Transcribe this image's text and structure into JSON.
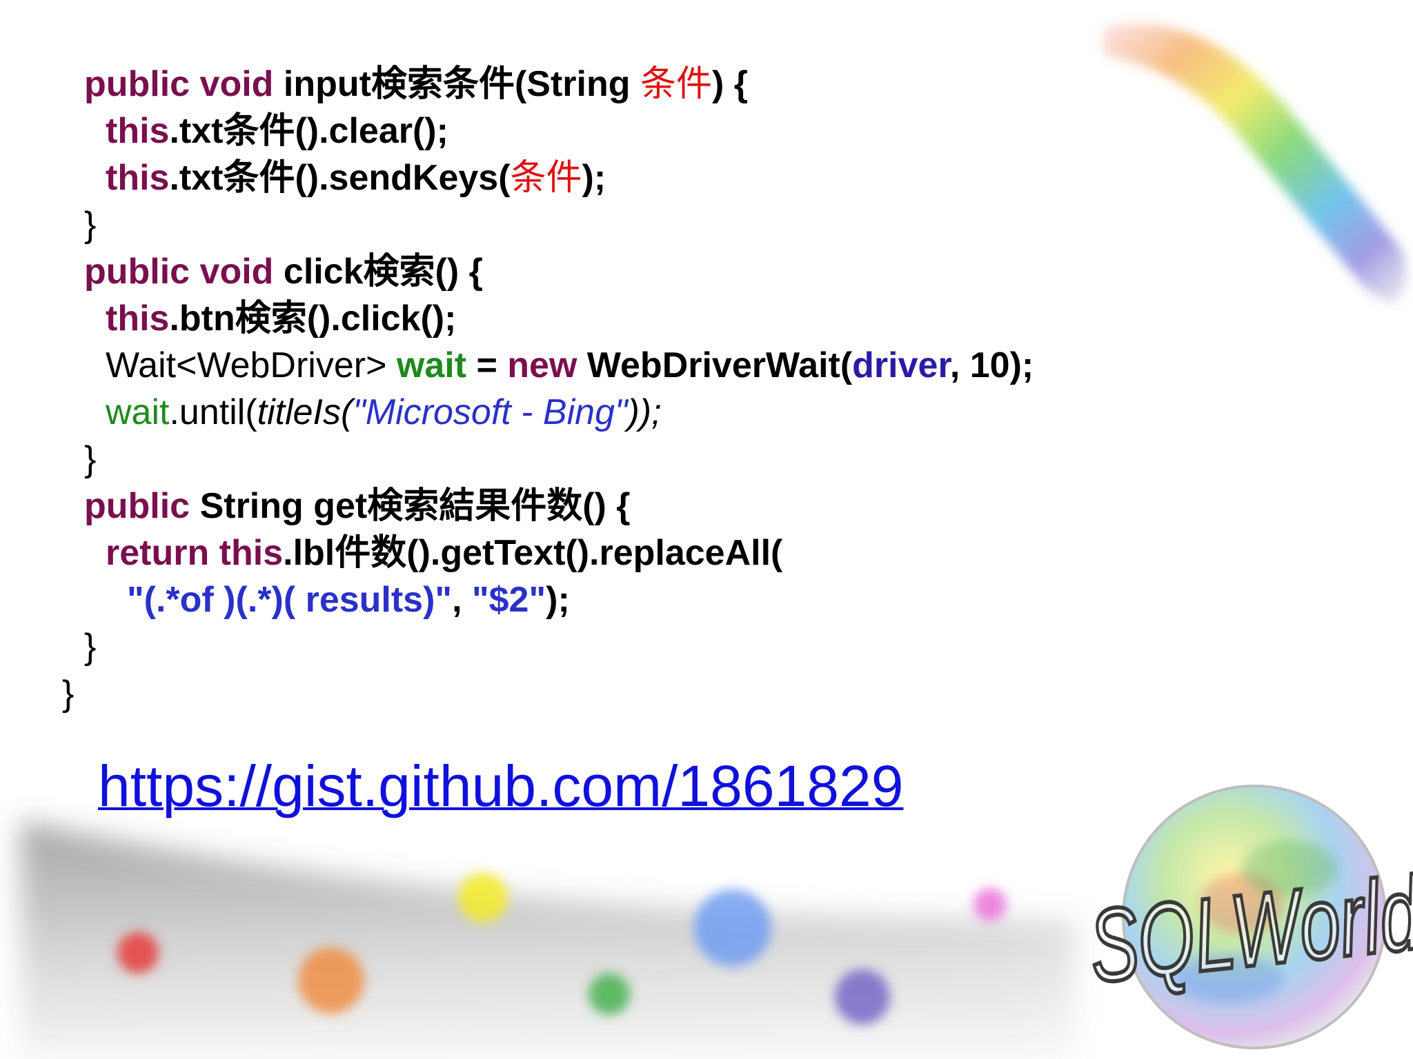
{
  "code": {
    "lines": [
      {
        "indent": 1,
        "tokens": [
          {
            "c": "kw",
            "t": "public void "
          },
          {
            "c": "b",
            "t": "input検索条件(String "
          },
          {
            "c": "param",
            "t": "条件"
          },
          {
            "c": "b",
            "t": ") {"
          }
        ]
      },
      {
        "indent": 2,
        "tokens": [
          {
            "c": "kw",
            "t": "this"
          },
          {
            "c": "b",
            "t": ".txt条件().clear();"
          }
        ]
      },
      {
        "indent": 2,
        "tokens": [
          {
            "c": "kw",
            "t": "this"
          },
          {
            "c": "b",
            "t": ".txt条件().sendKeys("
          },
          {
            "c": "param",
            "t": "条件"
          },
          {
            "c": "b",
            "t": ");"
          }
        ]
      },
      {
        "indent": 1,
        "tokens": [
          {
            "c": "",
            "t": "}"
          }
        ]
      },
      {
        "indent": 1,
        "tokens": [
          {
            "c": "kw",
            "t": "public void "
          },
          {
            "c": "b",
            "t": "click検索() {"
          }
        ]
      },
      {
        "indent": 2,
        "tokens": [
          {
            "c": "kw",
            "t": "this"
          },
          {
            "c": "b",
            "t": ".btn検索().click();"
          }
        ]
      },
      {
        "indent": 2,
        "tokens": [
          {
            "c": "",
            "t": "Wait<WebDriver> "
          },
          {
            "c": "loc",
            "t": "wait"
          },
          {
            "c": "b",
            "t": " = "
          },
          {
            "c": "kw",
            "t": "new "
          },
          {
            "c": "b",
            "t": "WebDriverWait("
          },
          {
            "c": "fld",
            "t": "driver"
          },
          {
            "c": "b",
            "t": ", 10);"
          }
        ]
      },
      {
        "indent": 2,
        "tokens": [
          {
            "c": "loc-n",
            "t": "wait"
          },
          {
            "c": "",
            "t": ".until("
          },
          {
            "c": "it",
            "t": "titleIs("
          },
          {
            "c": "strl",
            "t": "\"Microsoft - Bing\""
          },
          {
            "c": "it",
            "t": "));"
          }
        ]
      },
      {
        "indent": 1,
        "tokens": [
          {
            "c": "",
            "t": "}"
          }
        ]
      },
      {
        "indent": 1,
        "tokens": [
          {
            "c": "kw",
            "t": "public "
          },
          {
            "c": "b",
            "t": "String get検索結果件数() {"
          }
        ]
      },
      {
        "indent": 2,
        "tokens": [
          {
            "c": "kw",
            "t": "return this"
          },
          {
            "c": "b",
            "t": ".lbl件数().getText().replaceAll("
          }
        ]
      },
      {
        "indent": 3,
        "tokens": [
          {
            "c": "str",
            "t": "\"(.*of )(.*)( results)\""
          },
          {
            "c": "b",
            "t": ", "
          },
          {
            "c": "str",
            "t": "\"$2\""
          },
          {
            "c": "b",
            "t": ");"
          }
        ]
      },
      {
        "indent": 1,
        "tokens": [
          {
            "c": "",
            "t": "}"
          }
        ]
      },
      {
        "indent": 0,
        "tokens": [
          {
            "c": "",
            "t": "}"
          }
        ]
      }
    ]
  },
  "link": {
    "text": "https://gist.github.com/1861829"
  },
  "logo": {
    "text": "SQLWorld"
  },
  "colors": {
    "keyword": "#7a0f4e",
    "parameter": "#e01010",
    "field": "#2a1ba7",
    "local": "#1e8a1e",
    "string": "#2a30c8",
    "link": "#1010dd"
  },
  "decor_icons": [
    "rainbow-ribbon",
    "grey-swoosh",
    "colored-dots",
    "globe-logo"
  ]
}
